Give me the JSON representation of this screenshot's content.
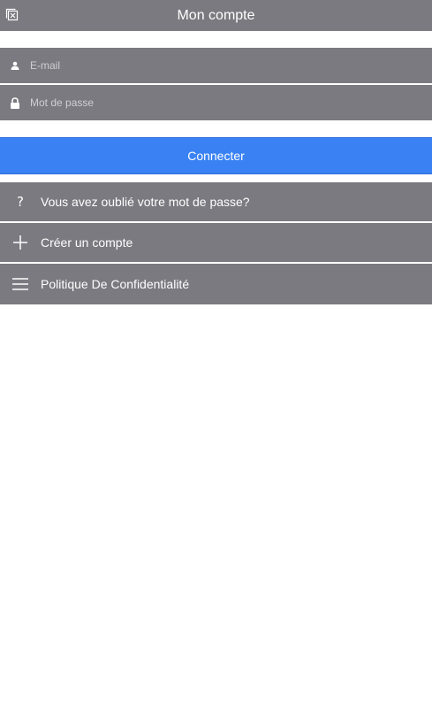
{
  "header": {
    "title": "Mon compte",
    "close_icon": "close-window-icon"
  },
  "form": {
    "email_placeholder": "E-mail",
    "email_value": "",
    "password_placeholder": "Mot de passe",
    "password_value": "",
    "submit_label": "Connecter"
  },
  "menu": {
    "items": [
      {
        "label": "Vous avez oublié votre mot de passe?",
        "icon": "question-icon"
      },
      {
        "label": "Créer un compte",
        "icon": "plus-icon"
      },
      {
        "label": "Politique De Confidentialité",
        "icon": "menu-lines-icon"
      }
    ]
  },
  "colors": {
    "panel": "#7b7a80",
    "primary": "#3a82f4",
    "text": "#ffffff"
  }
}
